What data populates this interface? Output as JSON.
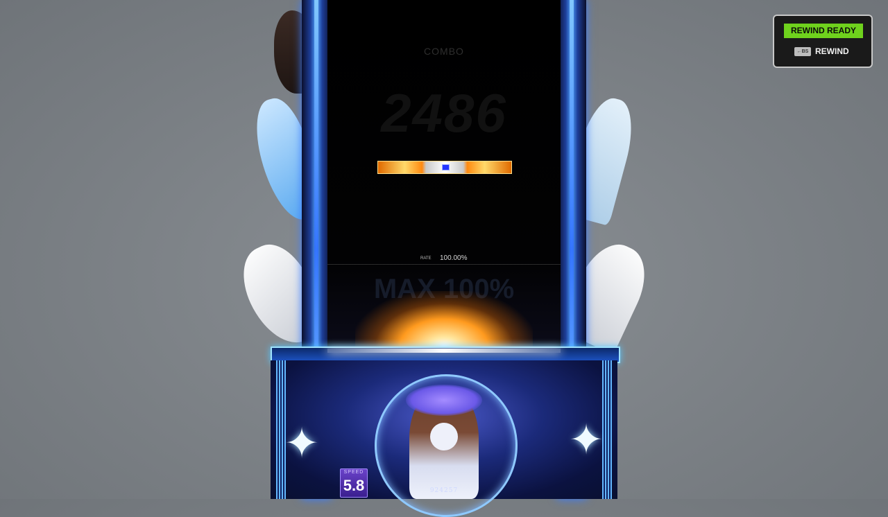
{
  "playfield": {
    "combo_label": "COMBO",
    "combo_value": "2486",
    "rate_label": "RATE",
    "rate_value": "100.00%",
    "max_text": "MAX 100%"
  },
  "hud": {
    "speed_label": "SPEED",
    "speed_value": "5.8",
    "score": "924257"
  },
  "rewind": {
    "ready_label": "REWIND READY",
    "key_label": "←BS",
    "action_label": "REWIND"
  },
  "colors": {
    "rewind_ready": "#6fd21d",
    "frame_accent": "#4fa3ff",
    "speed_box": "#6a42c9"
  },
  "icons": {
    "sparkle": "four-point-star-icon",
    "backspace": "backspace-key-icon"
  }
}
